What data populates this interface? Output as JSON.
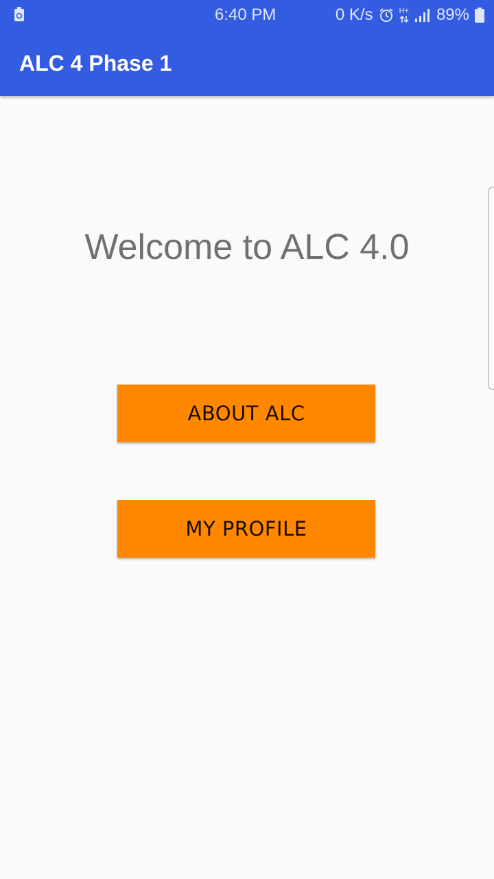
{
  "status_bar": {
    "time": "6:40 PM",
    "network_speed": "0 K/s",
    "network_type": "H+",
    "battery_percent": "89%",
    "icons": [
      "storage-cleaner-icon",
      "alarm-icon",
      "data-arrows-icon",
      "signal-icon",
      "battery-icon"
    ]
  },
  "app_bar": {
    "title": "ALC 4 Phase 1"
  },
  "main": {
    "welcome_text": "Welcome to ALC 4.0",
    "buttons": {
      "about_label": "ABOUT ALC",
      "profile_label": "MY PROFILE"
    }
  },
  "colors": {
    "primary": "#335ce0",
    "accent_button": "#ff8800",
    "background": "#fafafa",
    "welcome_text": "#707070"
  }
}
